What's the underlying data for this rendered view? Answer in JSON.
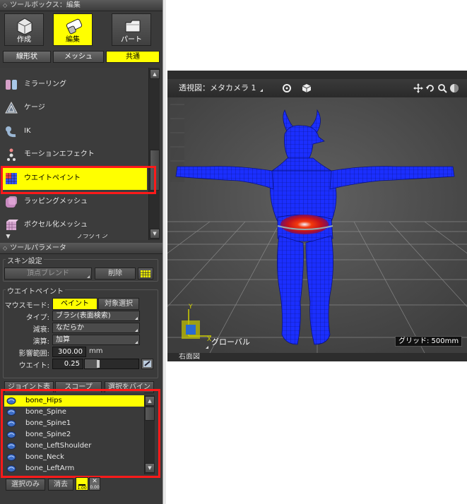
{
  "toolbox": {
    "title": "ツールボックス：編集",
    "modes": [
      {
        "label": "作成",
        "icon": "create-icon"
      },
      {
        "label": "編集",
        "icon": "edit-icon"
      },
      {
        "label": "パート",
        "icon": "part-icon"
      }
    ],
    "subtabs": [
      "線形状",
      "メッシュ",
      "共通"
    ],
    "tools": [
      {
        "label": "ミラーリング",
        "icon": "mirroring-icon"
      },
      {
        "label": "ケージ",
        "icon": "cage-icon"
      },
      {
        "label": "IK",
        "icon": "ik-icon"
      },
      {
        "label": "モーションエフェクト",
        "icon": "motion-effect-icon"
      },
      {
        "label": "ウエイトペイント",
        "icon": "weight-paint-icon"
      },
      {
        "label": "ラッピングメッシュ",
        "icon": "wrapping-mesh-icon"
      },
      {
        "label": "ボクセル化メッシュ",
        "icon": "voxel-mesh-icon"
      }
    ],
    "partial_item": "プラグイン"
  },
  "params": {
    "title": "ツールパラメータ",
    "skin": {
      "title": "スキン設定",
      "vertex_blend": "頂点ブレンド",
      "delete": "削除"
    },
    "weight": {
      "title": "ウエイトペイント",
      "mouse_mode_label": "マウスモード:",
      "mouse_mode_paint": "ペイント",
      "mouse_mode_select": "対象選択",
      "type_label": "タイプ:",
      "type_value": "ブラシ(表面検索)",
      "falloff_label": "減衰:",
      "falloff_value": "なだらか",
      "op_label": "演算:",
      "op_value": "加算",
      "range_label": "影響範囲:",
      "range_value": "300.00",
      "range_unit": "mm",
      "weight_label": "ウエイト:",
      "weight_value": "0.25",
      "weight_level": 0.25
    },
    "buttons_row": [
      "ジョイント表",
      "スコープ",
      "選択をバイン"
    ],
    "bones": [
      "bone_Hips",
      "bone_Spine",
      "bone_Spine1",
      "bone_Spine2",
      "bone_LeftShoulder",
      "bone_Neck",
      "bone_LeftArm"
    ],
    "bottom_buttons": [
      "選択のみ",
      "消去"
    ],
    "weight_badge": "1.00",
    "zero_badge": "0.00"
  },
  "viewport": {
    "title": "透視図：メタカメラ 1",
    "grid_label": "グリッド: 500mm",
    "global_label": "グローバル",
    "axis_y": "Y",
    "axis_x": "X",
    "bottom_title": "右面図"
  },
  "colors": {
    "accent": "#ffff00",
    "highlight_border": "#ff1a1a",
    "mesh": "#1b2fff"
  }
}
